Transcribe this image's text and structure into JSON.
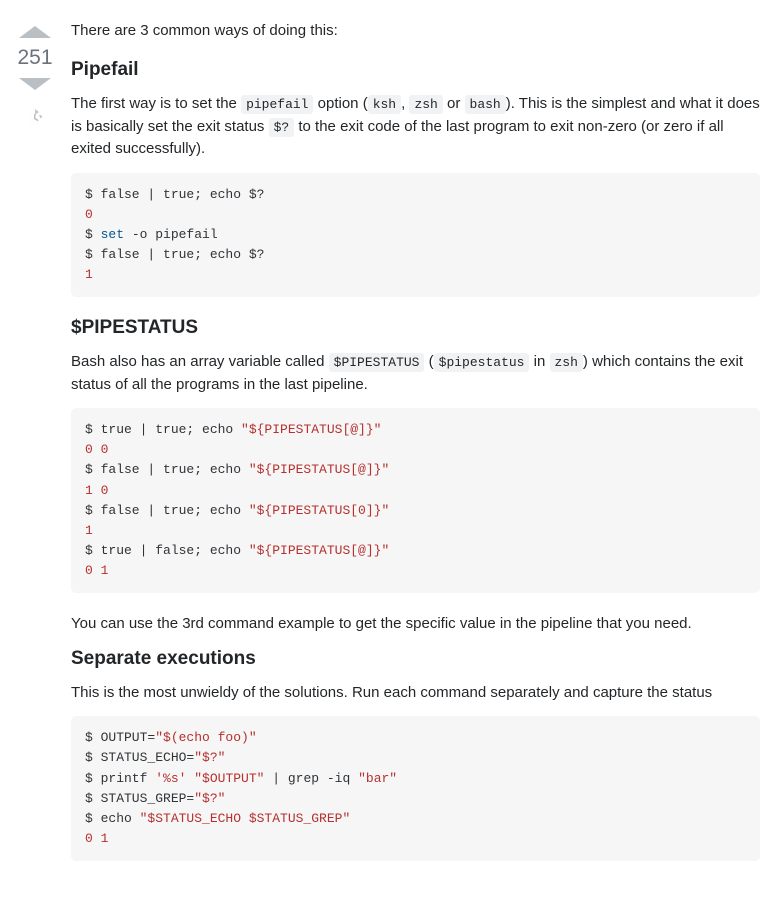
{
  "vote": {
    "count": "251"
  },
  "intro": "There are 3 common ways of doing this:",
  "s1": {
    "heading": "Pipefail",
    "p1_a": "The first way is to set the ",
    "p1_code1": "pipefail",
    "p1_b": " option (",
    "p1_code2": "ksh",
    "p1_c": ", ",
    "p1_code3": "zsh",
    "p1_d": " or ",
    "p1_code4": "bash",
    "p1_e": "). This is the simplest and what it does is basically set the exit status ",
    "p1_code5": "$?",
    "p1_f": " to the exit code of the last program to exit non-zero (or zero if all exited successfully).",
    "code": {
      "l1": "$ false | true; echo $?",
      "l2": "0",
      "l3a": "$ ",
      "l3b": "set",
      "l3c": " -o pipefail",
      "l4": "$ false | true; echo $?",
      "l5": "1"
    }
  },
  "s2": {
    "heading": "$PIPESTATUS",
    "p1_a": "Bash also has an array variable called ",
    "p1_code1": "$PIPESTATUS",
    "p1_b": " (",
    "p1_code2": "$pipestatus",
    "p1_c": " in ",
    "p1_code3": "zsh",
    "p1_d": ") which contains the exit status of all the programs in the last pipeline.",
    "code": {
      "l1a": "$ true | true; echo ",
      "l1b": "\"${PIPESTATUS[@]}\"",
      "l2": "0 0",
      "l3a": "$ false | true; echo ",
      "l3b": "\"${PIPESTATUS[@]}\"",
      "l4": "1 0",
      "l5a": "$ false | true; echo ",
      "l5b": "\"${PIPESTATUS[0]}\"",
      "l6": "1",
      "l7a": "$ true | false; echo ",
      "l7b": "\"${PIPESTATUS[@]}\"",
      "l8": "0 1"
    },
    "p2": "You can use the 3rd command example to get the specific value in the pipeline that you need."
  },
  "s3": {
    "heading": "Separate executions",
    "p1": "This is the most unwieldy of the solutions. Run each command separately and capture the status",
    "code": {
      "l1a": "$ OUTPUT=",
      "l1b": "\"$(echo foo)\"",
      "l2a": "$ STATUS_ECHO=",
      "l2b": "\"$?\"",
      "l3a": "$ printf ",
      "l3b": "'%s'",
      "l3c": " ",
      "l3d": "\"$OUTPUT\"",
      "l3e": " | grep -iq ",
      "l3f": "\"bar\"",
      "l4a": "$ STATUS_GREP=",
      "l4b": "\"$?\"",
      "l5a": "$ echo ",
      "l5b": "\"$STATUS_ECHO $STATUS_GREP\"",
      "l6": "0 1"
    }
  }
}
